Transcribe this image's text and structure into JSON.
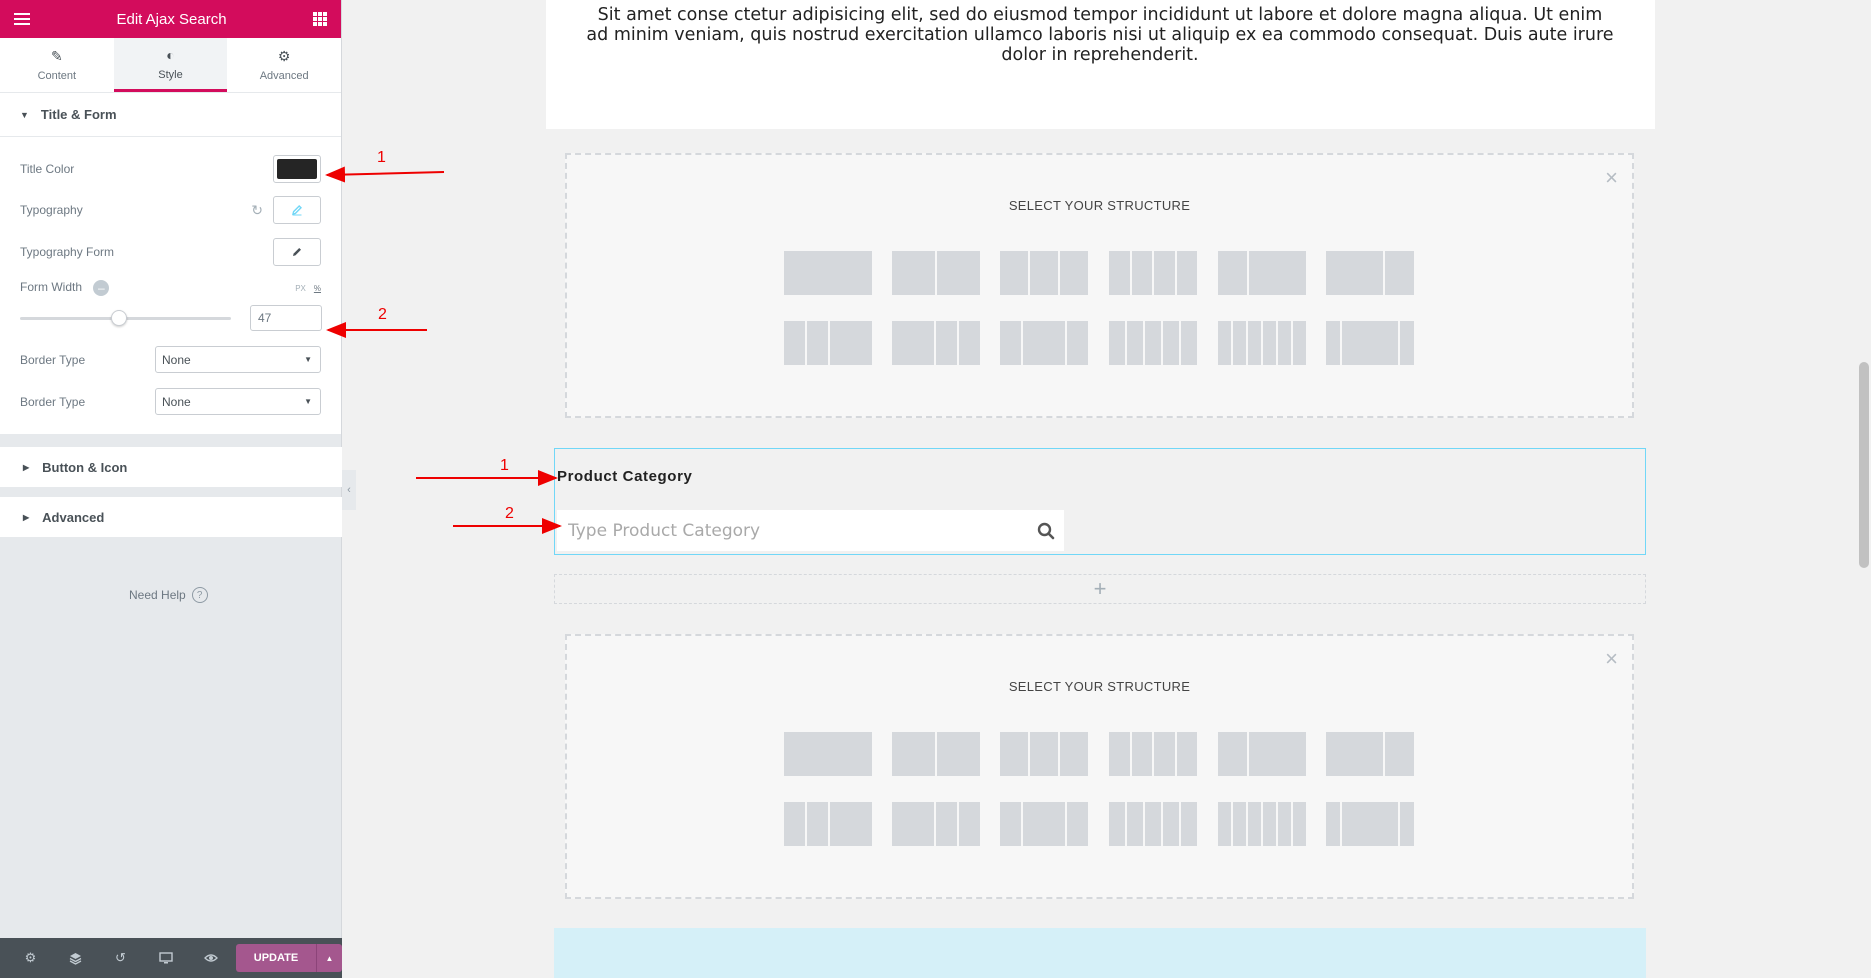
{
  "panel": {
    "title": "Edit Ajax Search",
    "tabs": [
      {
        "label": "Content",
        "icon": "pencil-icon"
      },
      {
        "label": "Style",
        "icon": "contrast-icon"
      },
      {
        "label": "Advanced",
        "icon": "gear-icon"
      }
    ],
    "active_tab": "Style",
    "sections": {
      "title_form": "Title & Form",
      "button_icon": "Button & Icon",
      "advanced": "Advanced"
    },
    "controls": {
      "title_color_label": "Title Color",
      "title_color_value": "#252525",
      "typography_label": "Typography",
      "typography_form_label": "Typography Form",
      "form_width_label": "Form Width",
      "form_width_units": [
        "PX",
        "%"
      ],
      "form_width_value": "47",
      "form_width_fraction": 0.47,
      "border_type_1_label": "Border Type",
      "border_type_1_value": "None",
      "border_type_2_label": "Border Type",
      "border_type_2_value": "None"
    },
    "need_help": "Need Help",
    "footer": {
      "update_label": "UPDATE",
      "icons": [
        "settings-icon",
        "layers-icon",
        "history-icon",
        "responsive-icon",
        "preview-eye-icon"
      ]
    }
  },
  "preview": {
    "intro_text": "Sit amet conse ctetur adipisicing elit, sed do eiusmod tempor incididunt ut labore et dolore magna aliqua. Ut enim ad minim veniam, quis nostrud exercitation ullamco laboris nisi ut aliquip ex ea commodo consequat. Duis aute irure dolor in reprehenderit.",
    "structure_title": "SELECT YOUR STRUCTURE",
    "product_category_title": "Product Category",
    "search_placeholder": "Type Product Category"
  },
  "annotations": [
    "1",
    "2",
    "1",
    "2"
  ],
  "colors": {
    "brand": "#d30c5c",
    "update": "#a4578e",
    "selection_outline": "#71d7f7",
    "arrow": "#e00000"
  }
}
